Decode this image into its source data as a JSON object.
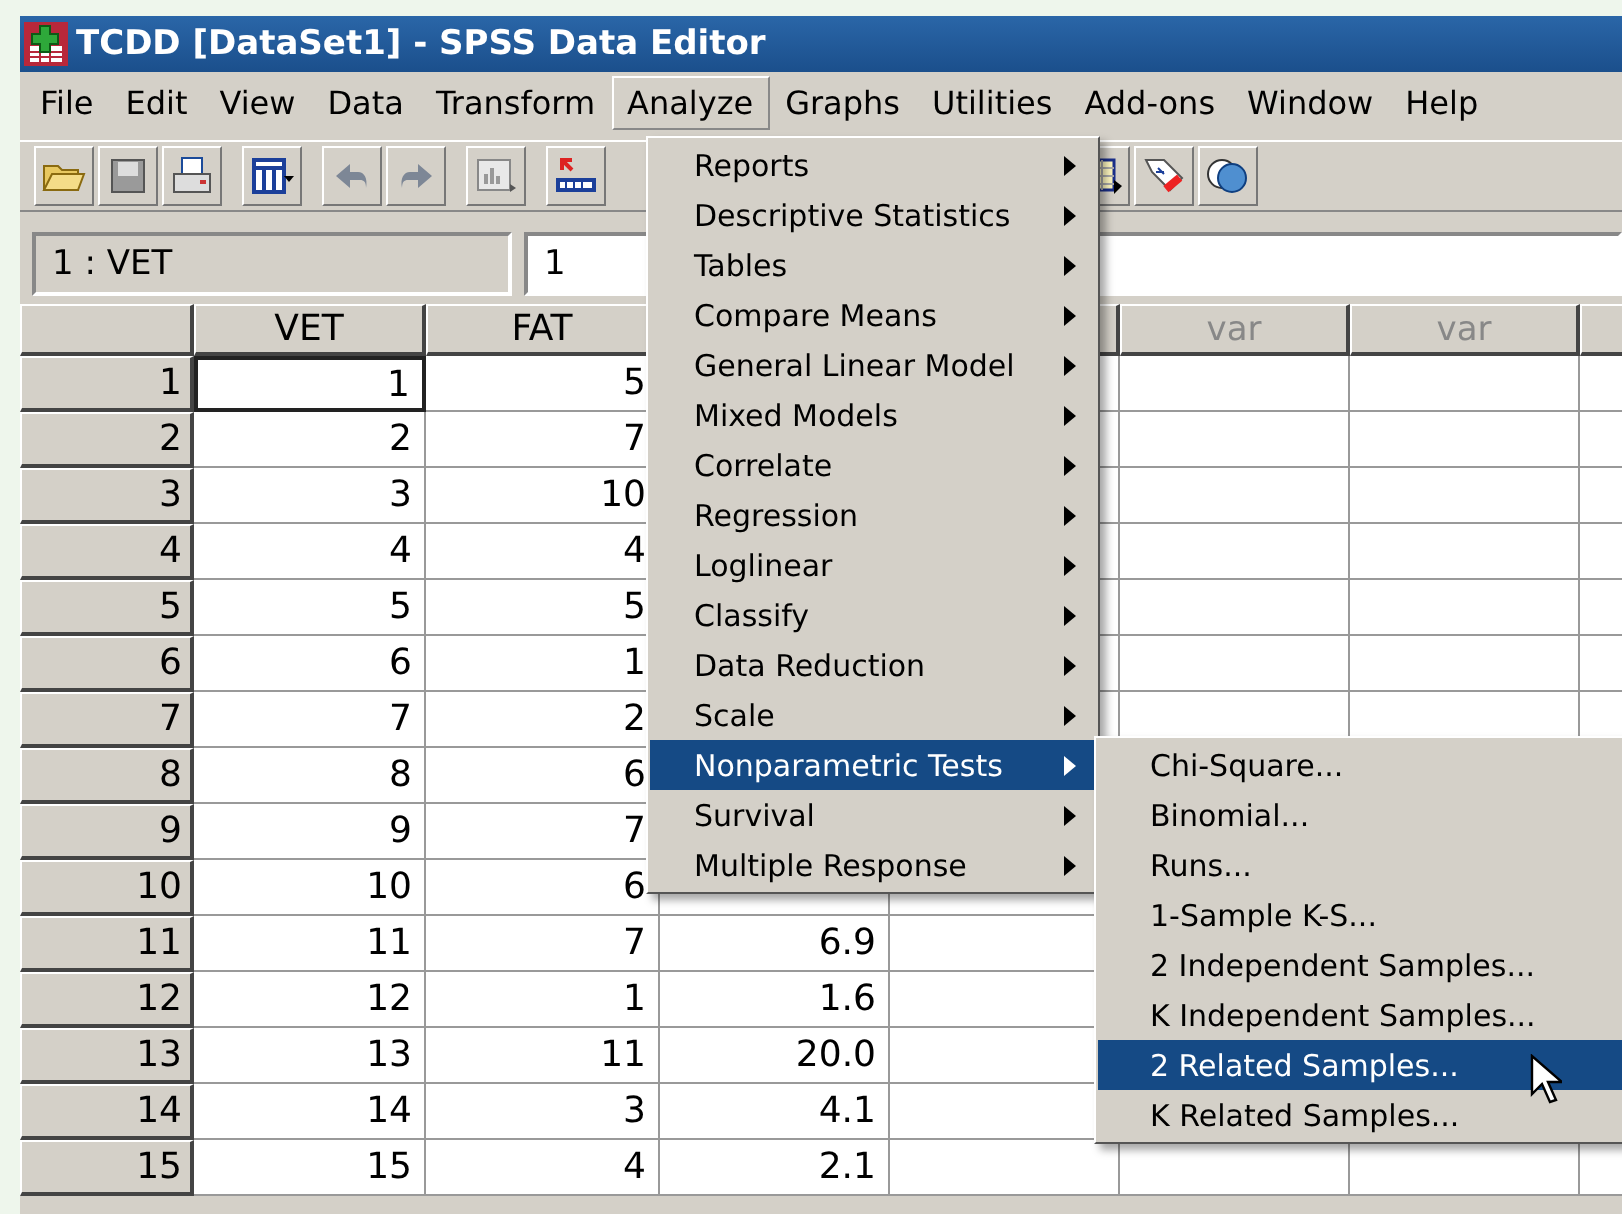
{
  "window": {
    "title": "TCDD [DataSet1] - SPSS Data Editor"
  },
  "menubar": [
    {
      "label": "File",
      "selected": false
    },
    {
      "label": "Edit",
      "selected": false
    },
    {
      "label": "View",
      "selected": false
    },
    {
      "label": "Data",
      "selected": false
    },
    {
      "label": "Transform",
      "selected": false
    },
    {
      "label": "Analyze",
      "selected": true
    },
    {
      "label": "Graphs",
      "selected": false
    },
    {
      "label": "Utilities",
      "selected": false
    },
    {
      "label": "Add-ons",
      "selected": false
    },
    {
      "label": "Window",
      "selected": false
    },
    {
      "label": "Help",
      "selected": false
    }
  ],
  "cell_editor": {
    "cell": "1 : VET",
    "value": "1"
  },
  "columns": [
    {
      "label": "VET"
    },
    {
      "label": "FAT"
    }
  ],
  "var_columns": [
    {
      "label": "var"
    },
    {
      "label": "var"
    }
  ],
  "rows": [
    {
      "number": "1",
      "vet": "1",
      "fat": "5",
      "selected": true
    },
    {
      "number": "2",
      "vet": "2",
      "fat": "7",
      "selected": false
    },
    {
      "number": "3",
      "vet": "3",
      "fat": "10",
      "selected": false
    },
    {
      "number": "4",
      "vet": "4",
      "fat": "4",
      "selected": false
    },
    {
      "number": "5",
      "vet": "5",
      "fat": "5",
      "selected": false
    },
    {
      "number": "6",
      "vet": "6",
      "fat": "1",
      "selected": false
    },
    {
      "number": "7",
      "vet": "7",
      "fat": "2",
      "selected": false
    },
    {
      "number": "8",
      "vet": "8",
      "fat": "6",
      "selected": false
    },
    {
      "number": "9",
      "vet": "9",
      "fat": "7",
      "selected": false
    },
    {
      "number": "10",
      "vet": "10",
      "fat": "6",
      "selected": false
    },
    {
      "number": "11",
      "vet": "11",
      "fat": "7",
      "column_4": "6.9",
      "selected": false
    },
    {
      "number": "12",
      "vet": "12",
      "fat": "1",
      "column_4": "1.6",
      "selected": false
    },
    {
      "number": "13",
      "vet": "13",
      "fat": "11",
      "column_4": "20.0",
      "selected": false
    },
    {
      "number": "14",
      "vet": "14",
      "fat": "3",
      "column_4": "4.1",
      "selected": false
    },
    {
      "number": "15",
      "vet": "15",
      "fat": "4",
      "column_4": "2.1",
      "selected": false
    }
  ],
  "analyze_menu": [
    {
      "label": "Reports",
      "submenu": true,
      "selected": false
    },
    {
      "label": "Descriptive Statistics",
      "submenu": true,
      "selected": false
    },
    {
      "label": "Tables",
      "submenu": true,
      "selected": false
    },
    {
      "label": "Compare Means",
      "submenu": true,
      "selected": false
    },
    {
      "label": "General Linear Model",
      "submenu": true,
      "selected": false
    },
    {
      "label": "Mixed Models",
      "submenu": true,
      "selected": false
    },
    {
      "label": "Correlate",
      "submenu": true,
      "selected": false
    },
    {
      "label": "Regression",
      "submenu": true,
      "selected": false
    },
    {
      "label": "Loglinear",
      "submenu": true,
      "selected": false
    },
    {
      "label": "Classify",
      "submenu": true,
      "selected": false
    },
    {
      "label": "Data Reduction",
      "submenu": true,
      "selected": false
    },
    {
      "label": "Scale",
      "submenu": true,
      "selected": false
    },
    {
      "label": "Nonparametric Tests",
      "submenu": true,
      "selected": true
    },
    {
      "label": "Survival",
      "submenu": true,
      "selected": false
    },
    {
      "label": "Multiple Response",
      "submenu": true,
      "selected": false
    }
  ],
  "nonparametric_submenu": [
    {
      "label": "Chi-Square...",
      "selected": false
    },
    {
      "label": "Binomial...",
      "selected": false
    },
    {
      "label": "Runs...",
      "selected": false
    },
    {
      "label": "1-Sample K-S...",
      "selected": false
    },
    {
      "label": "2 Independent Samples...",
      "selected": false
    },
    {
      "label": "K Independent Samples...",
      "selected": false
    },
    {
      "label": "2 Related Samples...",
      "selected": true
    },
    {
      "label": "K Related Samples...",
      "selected": false
    }
  ]
}
